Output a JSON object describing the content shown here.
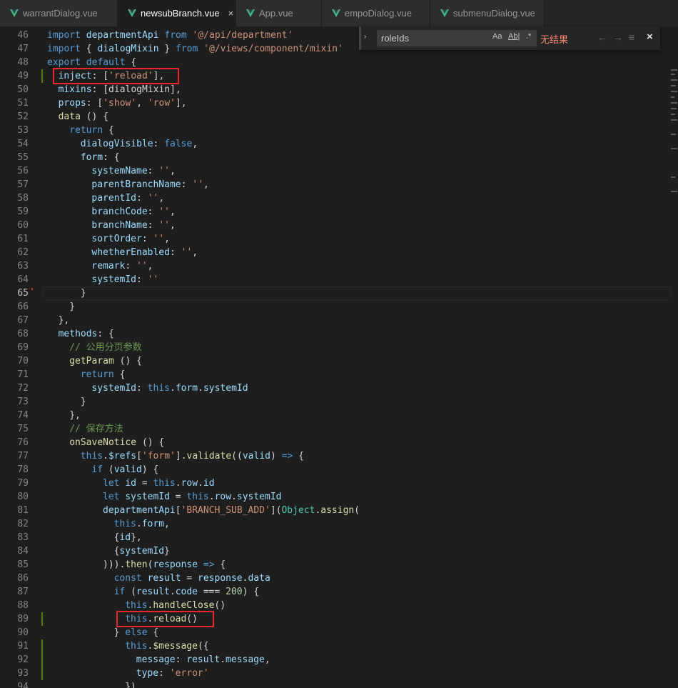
{
  "tabs": [
    {
      "label": "warrantDialog.vue",
      "active": false
    },
    {
      "label": "newsubBranch.vue",
      "active": true
    },
    {
      "label": "App.vue",
      "active": false
    },
    {
      "label": "empoDialog.vue",
      "active": false
    },
    {
      "label": "submenuDialog.vue",
      "active": false
    }
  ],
  "tab_close_glyph": "×",
  "find": {
    "query": "roleIds",
    "no_results": "无结果",
    "toggle_glyph": "›",
    "match_case_label": "Aa",
    "whole_word_label": "Ab|",
    "regex_label": ".*",
    "prev_glyph": "←",
    "next_glyph": "→",
    "selection_glyph": "≡",
    "close_glyph": "×"
  },
  "colors": {
    "background": "#1e1e1e",
    "keyword": "#569cd6",
    "string": "#ce9178",
    "variable": "#9cdcfe",
    "function": "#dcdcaa",
    "comment": "#6a9955",
    "highlight_box": "#e8262f",
    "no_results": "#f48771"
  },
  "icons": {
    "vue_file": "vue-logo-icon"
  },
  "code_lines": [
    {
      "n": "46",
      "indent": 0,
      "tokens": [
        [
          "k",
          "import "
        ],
        [
          "v",
          "departmentApi "
        ],
        [
          "k",
          "from "
        ],
        [
          "s",
          "'@/api/department'"
        ]
      ]
    },
    {
      "n": "47",
      "indent": 0,
      "tokens": [
        [
          "k",
          "import "
        ],
        [
          "p",
          "{ "
        ],
        [
          "v",
          "dialogMixin "
        ],
        [
          "p",
          "} "
        ],
        [
          "k",
          "from "
        ],
        [
          "s",
          "'@/views/component/mixin'"
        ]
      ]
    },
    {
      "n": "48",
      "indent": 0,
      "tokens": [
        [
          "k",
          "export default "
        ],
        [
          "p",
          "{"
        ]
      ]
    },
    {
      "n": "49",
      "indent": 1,
      "tokens": [
        [
          "v",
          "inject"
        ],
        [
          "p",
          ": ["
        ],
        [
          "s",
          "'reload'"
        ],
        [
          "p",
          "],"
        ]
      ]
    },
    {
      "n": "50",
      "indent": 1,
      "tokens": [
        [
          "v",
          "mixins"
        ],
        [
          "p",
          ": [dialogMixin],"
        ]
      ]
    },
    {
      "n": "51",
      "indent": 1,
      "tokens": [
        [
          "v",
          "props"
        ],
        [
          "p",
          ": ["
        ],
        [
          "s",
          "'show'"
        ],
        [
          "p",
          ", "
        ],
        [
          "s",
          "'row'"
        ],
        [
          "p",
          "],"
        ]
      ]
    },
    {
      "n": "52",
      "indent": 1,
      "tokens": [
        [
          "f",
          "data "
        ],
        [
          "p",
          "() {"
        ]
      ]
    },
    {
      "n": "53",
      "indent": 2,
      "tokens": [
        [
          "k",
          "return "
        ],
        [
          "p",
          "{"
        ]
      ]
    },
    {
      "n": "54",
      "indent": 3,
      "tokens": [
        [
          "v",
          "dialogVisible"
        ],
        [
          "p",
          ": "
        ],
        [
          "k",
          "false"
        ],
        [
          "p",
          ","
        ]
      ]
    },
    {
      "n": "55",
      "indent": 3,
      "tokens": [
        [
          "v",
          "form"
        ],
        [
          "p",
          ": {"
        ]
      ]
    },
    {
      "n": "56",
      "indent": 4,
      "tokens": [
        [
          "v",
          "systemName"
        ],
        [
          "p",
          ": "
        ],
        [
          "s",
          "''"
        ],
        [
          "p",
          ","
        ]
      ]
    },
    {
      "n": "57",
      "indent": 4,
      "tokens": [
        [
          "v",
          "parentBranchName"
        ],
        [
          "p",
          ": "
        ],
        [
          "s",
          "''"
        ],
        [
          "p",
          ","
        ]
      ]
    },
    {
      "n": "58",
      "indent": 4,
      "tokens": [
        [
          "v",
          "parentId"
        ],
        [
          "p",
          ": "
        ],
        [
          "s",
          "''"
        ],
        [
          "p",
          ","
        ]
      ]
    },
    {
      "n": "59",
      "indent": 4,
      "tokens": [
        [
          "v",
          "branchCode"
        ],
        [
          "p",
          ": "
        ],
        [
          "s",
          "''"
        ],
        [
          "p",
          ","
        ]
      ]
    },
    {
      "n": "60",
      "indent": 4,
      "tokens": [
        [
          "v",
          "branchName"
        ],
        [
          "p",
          ": "
        ],
        [
          "s",
          "''"
        ],
        [
          "p",
          ","
        ]
      ]
    },
    {
      "n": "61",
      "indent": 4,
      "tokens": [
        [
          "v",
          "sortOrder"
        ],
        [
          "p",
          ": "
        ],
        [
          "s",
          "''"
        ],
        [
          "p",
          ","
        ]
      ]
    },
    {
      "n": "62",
      "indent": 4,
      "tokens": [
        [
          "v",
          "whetherEnabled"
        ],
        [
          "p",
          ": "
        ],
        [
          "s",
          "''"
        ],
        [
          "p",
          ","
        ]
      ]
    },
    {
      "n": "63",
      "indent": 4,
      "tokens": [
        [
          "v",
          "remark"
        ],
        [
          "p",
          ": "
        ],
        [
          "s",
          "''"
        ],
        [
          "p",
          ","
        ]
      ]
    },
    {
      "n": "64",
      "indent": 4,
      "tokens": [
        [
          "v",
          "systemId"
        ],
        [
          "p",
          ": "
        ],
        [
          "s",
          "''"
        ]
      ]
    },
    {
      "n": "65",
      "indent": 3,
      "tokens": [
        [
          "p",
          "}"
        ]
      ]
    },
    {
      "n": "66",
      "indent": 2,
      "tokens": [
        [
          "p",
          "}"
        ]
      ]
    },
    {
      "n": "67",
      "indent": 1,
      "tokens": [
        [
          "p",
          "},"
        ]
      ]
    },
    {
      "n": "68",
      "indent": 1,
      "tokens": [
        [
          "v",
          "methods"
        ],
        [
          "p",
          ": {"
        ]
      ]
    },
    {
      "n": "69",
      "indent": 2,
      "tokens": [
        [
          "c",
          "// 公用分页参数"
        ]
      ]
    },
    {
      "n": "70",
      "indent": 2,
      "tokens": [
        [
          "f",
          "getParam "
        ],
        [
          "p",
          "() {"
        ]
      ]
    },
    {
      "n": "71",
      "indent": 3,
      "tokens": [
        [
          "k",
          "return "
        ],
        [
          "p",
          "{"
        ]
      ]
    },
    {
      "n": "72",
      "indent": 4,
      "tokens": [
        [
          "v",
          "systemId"
        ],
        [
          "p",
          ": "
        ],
        [
          "k",
          "this"
        ],
        [
          "p",
          "."
        ],
        [
          "v",
          "form"
        ],
        [
          "p",
          "."
        ],
        [
          "v",
          "systemId"
        ]
      ]
    },
    {
      "n": "73",
      "indent": 3,
      "tokens": [
        [
          "p",
          "}"
        ]
      ]
    },
    {
      "n": "74",
      "indent": 2,
      "tokens": [
        [
          "p",
          "},"
        ]
      ]
    },
    {
      "n": "75",
      "indent": 2,
      "tokens": [
        [
          "c",
          "// 保存方法"
        ]
      ]
    },
    {
      "n": "76",
      "indent": 2,
      "tokens": [
        [
          "f",
          "onSaveNotice "
        ],
        [
          "p",
          "() {"
        ]
      ]
    },
    {
      "n": "77",
      "indent": 3,
      "tokens": [
        [
          "k",
          "this"
        ],
        [
          "p",
          "."
        ],
        [
          "v",
          "$refs"
        ],
        [
          "p",
          "["
        ],
        [
          "s",
          "'form'"
        ],
        [
          "p",
          "]."
        ],
        [
          "f",
          "validate"
        ],
        [
          "p",
          "(("
        ],
        [
          "v",
          "valid"
        ],
        [
          "p",
          ") "
        ],
        [
          "k",
          "=> "
        ],
        [
          "p",
          "{"
        ]
      ]
    },
    {
      "n": "78",
      "indent": 4,
      "tokens": [
        [
          "k",
          "if "
        ],
        [
          "p",
          "("
        ],
        [
          "v",
          "valid"
        ],
        [
          "p",
          ") {"
        ]
      ]
    },
    {
      "n": "79",
      "indent": 5,
      "tokens": [
        [
          "k",
          "let "
        ],
        [
          "v",
          "id "
        ],
        [
          "p",
          "= "
        ],
        [
          "k",
          "this"
        ],
        [
          "p",
          "."
        ],
        [
          "v",
          "row"
        ],
        [
          "p",
          "."
        ],
        [
          "v",
          "id"
        ]
      ]
    },
    {
      "n": "80",
      "indent": 5,
      "tokens": [
        [
          "k",
          "let "
        ],
        [
          "v",
          "systemId "
        ],
        [
          "p",
          "= "
        ],
        [
          "k",
          "this"
        ],
        [
          "p",
          "."
        ],
        [
          "v",
          "row"
        ],
        [
          "p",
          "."
        ],
        [
          "v",
          "systemId"
        ]
      ]
    },
    {
      "n": "81",
      "indent": 5,
      "tokens": [
        [
          "v",
          "departmentApi"
        ],
        [
          "p",
          "["
        ],
        [
          "s",
          "'BRANCH_SUB_ADD'"
        ],
        [
          "p",
          "]("
        ],
        [
          "t",
          "Object"
        ],
        [
          "p",
          "."
        ],
        [
          "f",
          "assign"
        ],
        [
          "p",
          "("
        ]
      ]
    },
    {
      "n": "82",
      "indent": 6,
      "tokens": [
        [
          "k",
          "this"
        ],
        [
          "p",
          "."
        ],
        [
          "v",
          "form"
        ],
        [
          "p",
          ","
        ]
      ]
    },
    {
      "n": "83",
      "indent": 6,
      "tokens": [
        [
          "p",
          "{"
        ],
        [
          "v",
          "id"
        ],
        [
          "p",
          "},"
        ]
      ]
    },
    {
      "n": "84",
      "indent": 6,
      "tokens": [
        [
          "p",
          "{"
        ],
        [
          "v",
          "systemId"
        ],
        [
          "p",
          "}"
        ]
      ]
    },
    {
      "n": "85",
      "indent": 5,
      "tokens": [
        [
          "p",
          ")))."
        ],
        [
          "f",
          "then"
        ],
        [
          "p",
          "("
        ],
        [
          "v",
          "response "
        ],
        [
          "k",
          "=> "
        ],
        [
          "p",
          "{"
        ]
      ]
    },
    {
      "n": "86",
      "indent": 6,
      "tokens": [
        [
          "k",
          "const "
        ],
        [
          "v",
          "result "
        ],
        [
          "p",
          "= "
        ],
        [
          "v",
          "response"
        ],
        [
          "p",
          "."
        ],
        [
          "v",
          "data"
        ]
      ]
    },
    {
      "n": "87",
      "indent": 6,
      "tokens": [
        [
          "k",
          "if "
        ],
        [
          "p",
          "("
        ],
        [
          "v",
          "result"
        ],
        [
          "p",
          "."
        ],
        [
          "v",
          "code "
        ],
        [
          "p",
          "=== "
        ],
        [
          "n",
          "200"
        ],
        [
          "p",
          ") {"
        ]
      ]
    },
    {
      "n": "88",
      "indent": 7,
      "tokens": [
        [
          "k",
          "this"
        ],
        [
          "p",
          "."
        ],
        [
          "f",
          "handleClose"
        ],
        [
          "p",
          "()"
        ]
      ]
    },
    {
      "n": "89",
      "indent": 7,
      "tokens": [
        [
          "k",
          "this"
        ],
        [
          "p",
          "."
        ],
        [
          "f",
          "reload"
        ],
        [
          "p",
          "()"
        ]
      ]
    },
    {
      "n": "90",
      "indent": 6,
      "tokens": [
        [
          "p",
          "} "
        ],
        [
          "k",
          "else "
        ],
        [
          "p",
          "{"
        ]
      ]
    },
    {
      "n": "91",
      "indent": 7,
      "tokens": [
        [
          "k",
          "this"
        ],
        [
          "p",
          "."
        ],
        [
          "f",
          "$message"
        ],
        [
          "p",
          "({"
        ]
      ]
    },
    {
      "n": "92",
      "indent": 8,
      "tokens": [
        [
          "v",
          "message"
        ],
        [
          "p",
          ": "
        ],
        [
          "v",
          "result"
        ],
        [
          "p",
          "."
        ],
        [
          "v",
          "message"
        ],
        [
          "p",
          ","
        ]
      ]
    },
    {
      "n": "93",
      "indent": 8,
      "tokens": [
        [
          "v",
          "type"
        ],
        [
          "p",
          ": "
        ],
        [
          "s",
          "'error'"
        ]
      ]
    },
    {
      "n": "94",
      "indent": 7,
      "tokens": [
        [
          "p",
          "})"
        ]
      ]
    }
  ]
}
